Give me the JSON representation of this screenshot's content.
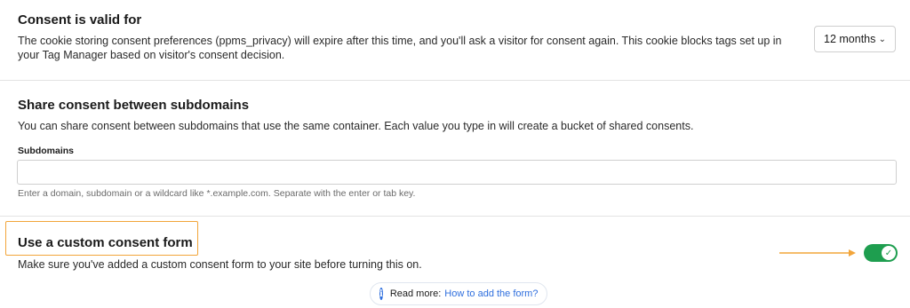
{
  "consent_validity": {
    "title": "Consent is valid for",
    "description": "The cookie storing consent preferences (ppms_privacy) will expire after this time, and you'll ask a visitor for consent again. This cookie blocks tags set up in your Tag Manager based on visitor's consent decision.",
    "duration_value": "12 months"
  },
  "share_consent": {
    "title": "Share consent between subdomains",
    "description": "You can share consent between subdomains that use the same container. Each value you type in will create a bucket of shared consents.",
    "field_label": "Subdomains",
    "field_value": "",
    "helper_text": "Enter a domain, subdomain or a wildcard like *.example.com. Separate with the enter or tab key."
  },
  "custom_form": {
    "title": "Use a custom consent form",
    "description": "Make sure you've added a custom consent form to your site before turning this on.",
    "toggle_on": true,
    "read_more_label": "Read more:",
    "read_more_link": "How to add the form?"
  },
  "colors": {
    "accent_green": "#1e9e4f",
    "highlight_orange": "#f2a53a",
    "link_blue": "#2f6fde"
  }
}
